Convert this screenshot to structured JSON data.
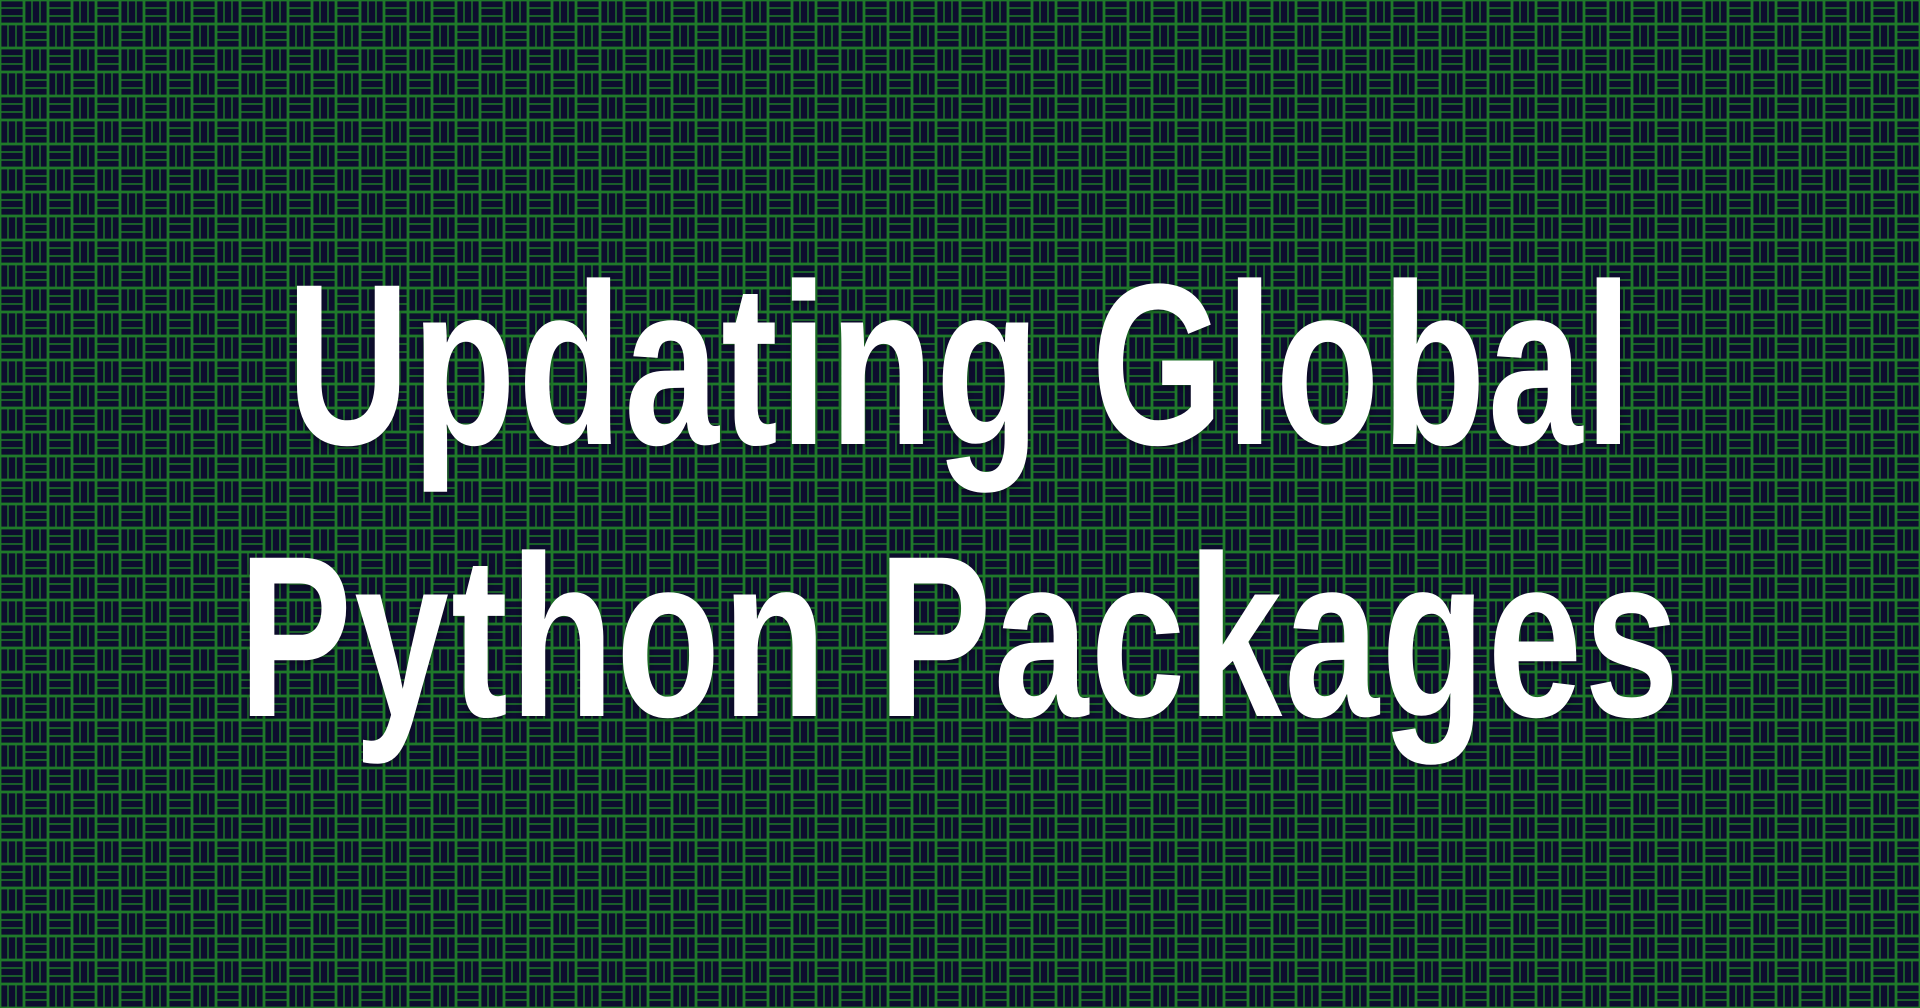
{
  "background": {
    "base_color": "#0d0d2e",
    "pattern_color": "#1f7a2a",
    "pattern_type": "basketweave"
  },
  "title": {
    "lines": [
      "Updating Global",
      "Python Packages"
    ],
    "color": "#ffffff"
  }
}
